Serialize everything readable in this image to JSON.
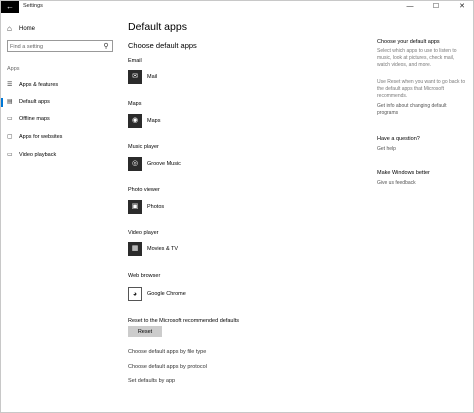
{
  "window": {
    "title": "Settings",
    "back_icon": "←",
    "controls": {
      "minimize": "—",
      "maximize": "☐",
      "close": "✕"
    }
  },
  "sidebar": {
    "home": {
      "icon": "⌂",
      "label": "Home"
    },
    "search": {
      "placeholder": "Find a setting",
      "icon": "⚲"
    },
    "section_label": "Apps",
    "items": [
      {
        "icon": "☰",
        "label": "Apps & features",
        "selected": false
      },
      {
        "icon": "▤",
        "label": "Default apps",
        "selected": true
      },
      {
        "icon": "▭",
        "label": "Offline maps",
        "selected": false
      },
      {
        "icon": "▢",
        "label": "Apps for websites",
        "selected": false
      },
      {
        "icon": "▭",
        "label": "Video playback",
        "selected": false
      }
    ]
  },
  "main": {
    "page_title": "Default apps",
    "sub_title": "Choose default apps",
    "categories": [
      {
        "label": "Email",
        "app_icon": "✉",
        "app_name": "Mail"
      },
      {
        "label": "Maps",
        "app_icon": "◉",
        "app_name": "Maps"
      },
      {
        "label": "Music player",
        "app_icon": "◎",
        "app_name": "Groove Music"
      },
      {
        "label": "Photo viewer",
        "app_icon": "▣",
        "app_name": "Photos"
      },
      {
        "label": "Video player",
        "app_icon": "▦",
        "app_name": "Movies & TV"
      },
      {
        "label": "Web browser",
        "app_icon": "◕",
        "app_name": "Google Chrome"
      }
    ],
    "reset_label": "Reset to the Microsoft recommended defaults",
    "reset_button": "Reset",
    "links": [
      "Choose default apps by file type",
      "Choose default apps by protocol",
      "Set defaults by app"
    ]
  },
  "right_panel": {
    "choose_heading": "Choose your default apps",
    "choose_text": "Select which apps to use to listen to music, look at pictures, check mail, watch videos, and more.",
    "reset_text": "Use Reset when you want to go back to the default apps that Microsoft recommends.",
    "info_link": "Get info about changing default programs",
    "question_heading": "Have a question?",
    "help_link": "Get help",
    "better_heading": "Make Windows better",
    "feedback_link": "Give us feedback"
  }
}
